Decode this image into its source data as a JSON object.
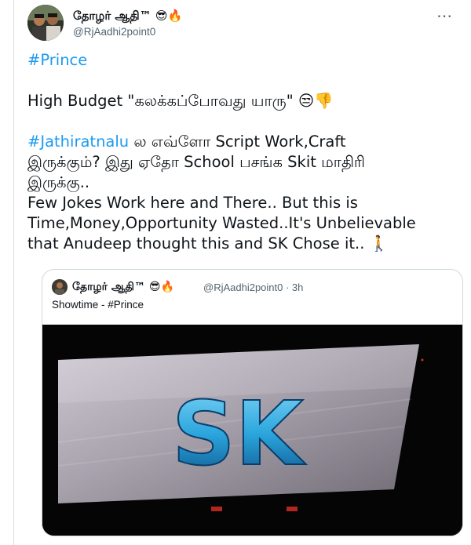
{
  "tweet": {
    "author_name": "தோழர் ஆதி™ 😎🔥",
    "author_handle": "@RjAadhi2point0",
    "more_icon": "more-icon",
    "lines": [
      {
        "kind": "hashtag",
        "text": "#Prince"
      },
      {
        "kind": "blank"
      },
      {
        "kind": "text",
        "text": "High Budget \"கலக்கப்போவது யாரு\" 😒👎"
      },
      {
        "kind": "blank"
      },
      {
        "kind": "mixed",
        "hashtag": "#Jathiratnalu",
        "text": " ல எவ்ளோ Script Work,Craft"
      },
      {
        "kind": "text",
        "text": "இருக்கும்? இது ஏதோ School பசங்க Skit மாதிரி"
      },
      {
        "kind": "text",
        "text": "இருக்கு.."
      },
      {
        "kind": "text",
        "text": "Few Jokes Work here and There.. But this is"
      },
      {
        "kind": "text",
        "text": "Time,Money,Opportunity Wasted..It's Unbelievable"
      },
      {
        "kind": "text",
        "text": "that Anudeep thought this and SK Chose it.. 🚶"
      }
    ]
  },
  "quoted": {
    "author_name": "தோழர் ஆதி™ 😎🔥",
    "author_handle": "@RjAadhi2point0 · 3h",
    "text": "Showtime - #Prince",
    "image_logo_text": "SK"
  },
  "colors": {
    "link": "#1d9bf0",
    "secondary": "#536471",
    "border": "#cfd9de"
  }
}
